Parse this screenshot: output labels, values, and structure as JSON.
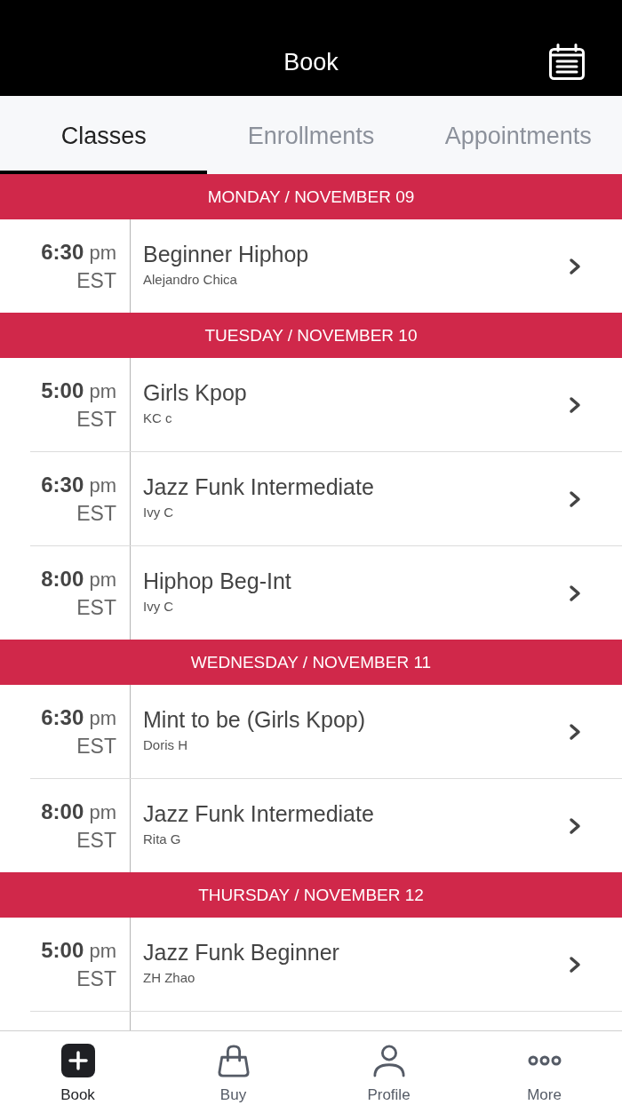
{
  "header": {
    "title": "Book"
  },
  "tabs": [
    {
      "label": "Classes",
      "selected": true
    },
    {
      "label": "Enrollments",
      "selected": false
    },
    {
      "label": "Appointments",
      "selected": false
    }
  ],
  "schedule": [
    {
      "day": "MONDAY / NOVEMBER 09",
      "classes": [
        {
          "time": "**6:30** pm",
          "zone": "EST",
          "name": "Beginner Hiphop",
          "instructor": "Alejandro Chica"
        }
      ]
    },
    {
      "day": "TUESDAY / NOVEMBER 10",
      "classes": [
        {
          "time": "**5:00** pm",
          "zone": "EST",
          "name": "Girls Kpop",
          "instructor": "KC c"
        },
        {
          "time": "**6:30** pm",
          "zone": "EST",
          "name": "Jazz Funk Intermediate",
          "instructor": "Ivy C"
        },
        {
          "time": "**8:00** pm",
          "zone": "EST",
          "name": "Hiphop Beg-Int",
          "instructor": "Ivy C"
        }
      ]
    },
    {
      "day": "WEDNESDAY / NOVEMBER 11",
      "classes": [
        {
          "time": "**6:30** pm",
          "zone": "EST",
          "name": "Mint to be (Girls Kpop)",
          "instructor": "Doris H"
        },
        {
          "time": "**8:00** pm",
          "zone": "EST",
          "name": "Jazz Funk Intermediate",
          "instructor": "Rita G"
        }
      ]
    },
    {
      "day": "THURSDAY / NOVEMBER 12",
      "classes": [
        {
          "time": "**5:00** pm",
          "zone": "EST",
          "name": "Jazz Funk Beginner",
          "instructor": "ZH Zhao"
        }
      ]
    }
  ],
  "bottom_nav": [
    {
      "label": "Book",
      "kind": "plus",
      "selected": true
    },
    {
      "label": "Buy",
      "kind": "bag",
      "selected": false
    },
    {
      "label": "Profile",
      "kind": "person",
      "selected": false
    },
    {
      "label": "More",
      "kind": "dots",
      "selected": false
    }
  ]
}
